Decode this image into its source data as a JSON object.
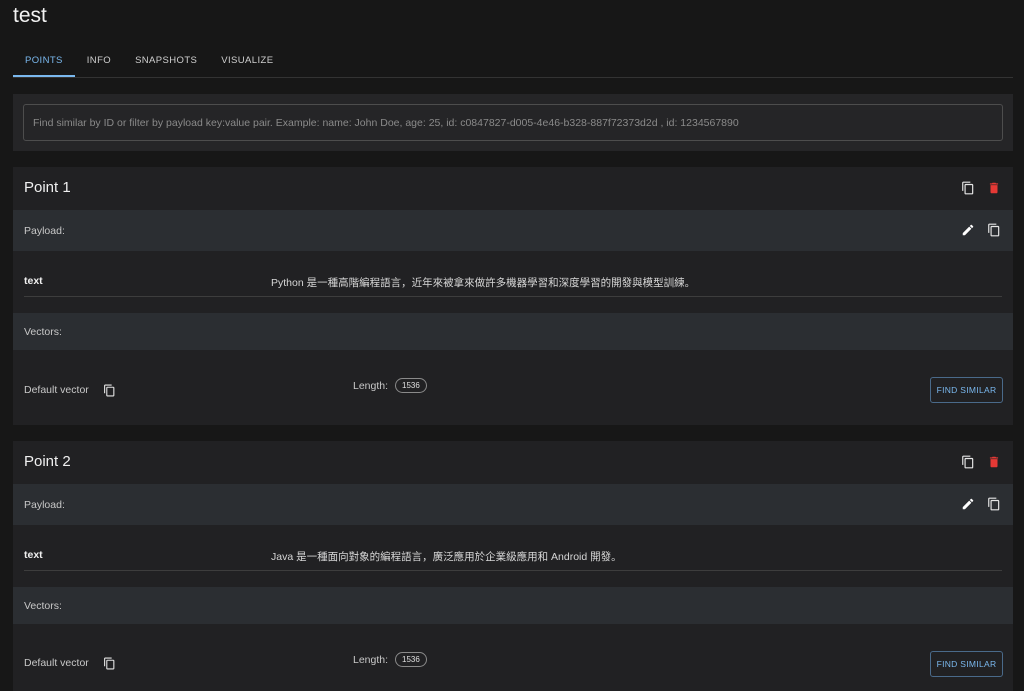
{
  "collection": {
    "title": "test"
  },
  "tabs": [
    {
      "label": "POINTS",
      "active": true
    },
    {
      "label": "INFO",
      "active": false
    },
    {
      "label": "SNAPSHOTS",
      "active": false
    },
    {
      "label": "VISUALIZE",
      "active": false
    }
  ],
  "search": {
    "placeholder": "Find similar by ID or filter by payload key:value pair. Example: name: John Doe, age: 25, id: c0847827-d005-4e46-b328-887f72373d2d , id: 1234567890",
    "value": ""
  },
  "points": [
    {
      "title": "Point 1",
      "payload_label": "Payload:",
      "payload": [
        {
          "key": "text",
          "value": "Python 是一種高階編程語言，近年來被拿來做許多機器學習和深度學習的開發與模型訓練。"
        }
      ],
      "vectors_label": "Vectors:",
      "vector": {
        "name": "Default vector",
        "length_label": "Length:",
        "length": "1536"
      },
      "find_similar_label": "FIND SIMILAR"
    },
    {
      "title": "Point 2",
      "payload_label": "Payload:",
      "payload": [
        {
          "key": "text",
          "value": "Java 是一種面向對象的編程語言，廣泛應用於企業級應用和 Android 開發。"
        }
      ],
      "vectors_label": "Vectors:",
      "vector": {
        "name": "Default vector",
        "length_label": "Length:",
        "length": "1536"
      },
      "find_similar_label": "FIND SIMILAR"
    }
  ],
  "icons": {
    "copy": "copy-icon",
    "delete": "delete-icon",
    "edit": "edit-icon"
  },
  "colors": {
    "accent": "#7ab8ee",
    "delete": "#e53935",
    "background": "#171717",
    "card": "#212123",
    "section": "#2b2e32"
  }
}
